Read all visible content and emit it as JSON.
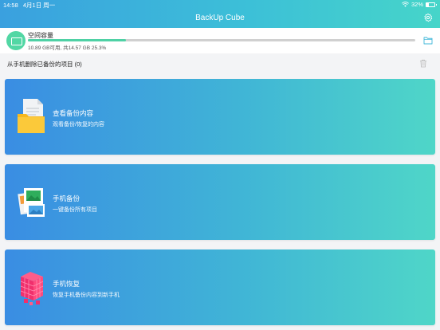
{
  "status_bar": {
    "time": "14:58",
    "date": "4月1日 周一",
    "battery_text": "32%",
    "battery_level": 0.32
  },
  "nav": {
    "title": "BackUp Cube"
  },
  "storage": {
    "label": "空间容量",
    "detail": "10.89 GB可用, 共14.57 GB 25.3%",
    "used_fraction": 0.253
  },
  "delete_row": {
    "label": "从手机删除已备份的项目 (0)"
  },
  "cards": [
    {
      "title": "查看备份内容",
      "subtitle": "观看备份/恢复的内容",
      "icon": "folder-document-icon"
    },
    {
      "title": "手机备份",
      "subtitle": "一键备份所有项目",
      "icon": "photos-backup-icon"
    },
    {
      "title": "手机恢复",
      "subtitle": "恢复手机备份内容到新手机",
      "icon": "cube-restore-icon"
    }
  ],
  "colors": {
    "accent_green": "#4fd1a5",
    "gradient_start": "#3a8de3",
    "gradient_end": "#4fd6c8"
  }
}
